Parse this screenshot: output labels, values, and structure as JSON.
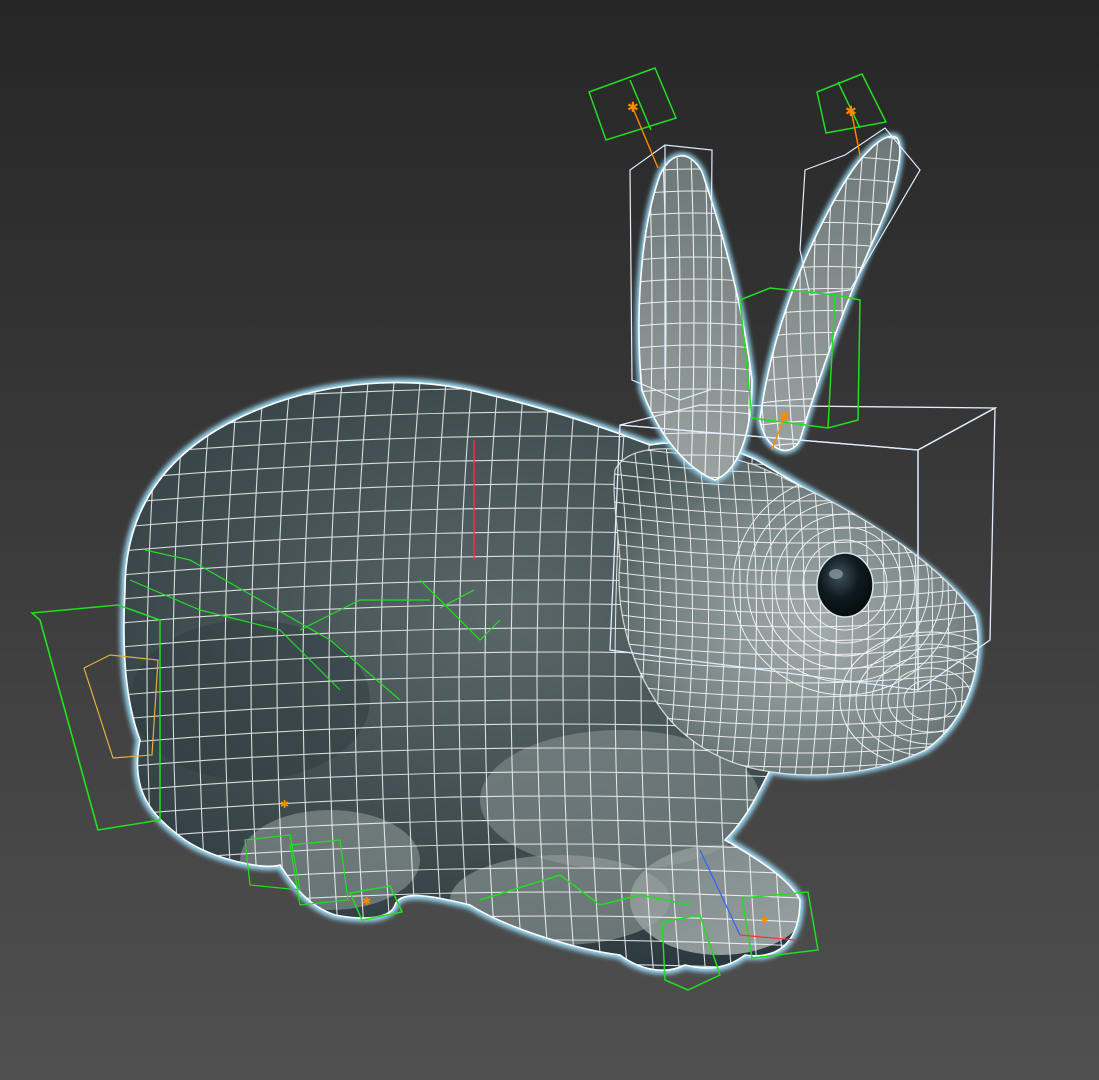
{
  "viewport": {
    "name": "3d-viewport",
    "background_top": "#262626",
    "background_bottom": "#505050"
  },
  "model": {
    "subject": "rabbit",
    "display_mode": "shaded-with-wireframe",
    "selected": true,
    "wire_color": "#ffffff",
    "selection_outline_color": "#9ee2ff",
    "fur_colors": [
      "#3b4a4e",
      "#6b7a7c",
      "#a7b2b0"
    ],
    "eye_color": "#0b1419"
  },
  "rig": {
    "bone_box_color": "#22dd22",
    "highlight_box_color": "#dfeeff",
    "secondary_box_color": "#e0b040",
    "pivot_color": "#ff8a00",
    "axis_colors": {
      "x": "#ff3333",
      "y": "#33cc33",
      "z": "#3366ff"
    }
  }
}
